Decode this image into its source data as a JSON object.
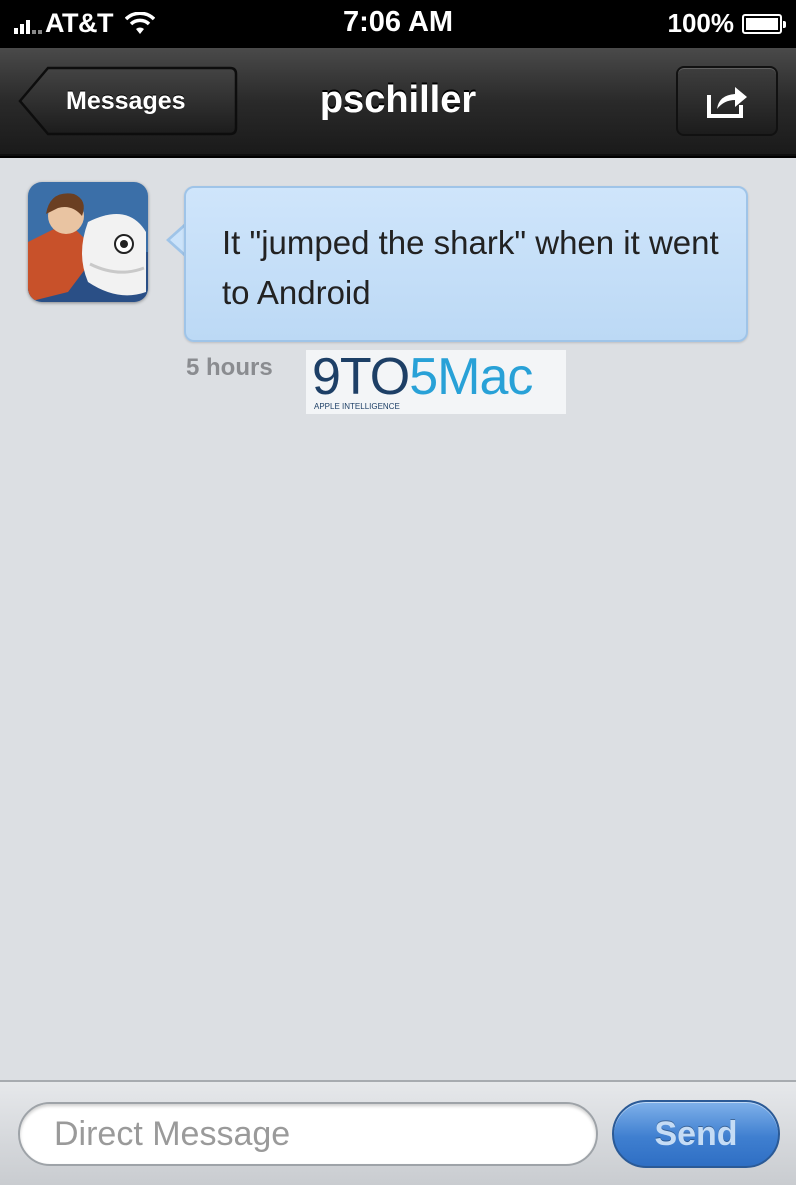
{
  "status_bar": {
    "carrier": "AT&T",
    "time": "7:06 AM",
    "battery": "100%",
    "battery_level": 1.0,
    "signal_icon": "signal-bars-icon",
    "wifi_icon": "wifi-icon"
  },
  "nav": {
    "back_label": "Messages",
    "title": "pschiller",
    "share_icon": "share-icon"
  },
  "conversation": {
    "messages": [
      {
        "sender": "pschiller",
        "text": "It \"jumped the shark\" when it went to Android",
        "timestamp": "5 hours"
      }
    ]
  },
  "watermark": {
    "dark_part": "9TO",
    "light_part": "5Mac",
    "tagline": "APPLE INTELLIGENCE"
  },
  "compose": {
    "placeholder": "Direct Message",
    "send_label": "Send"
  },
  "colors": {
    "bubble": "#c6e0f8",
    "background": "#dcdfe3",
    "send_button": "#3f7fd0"
  }
}
